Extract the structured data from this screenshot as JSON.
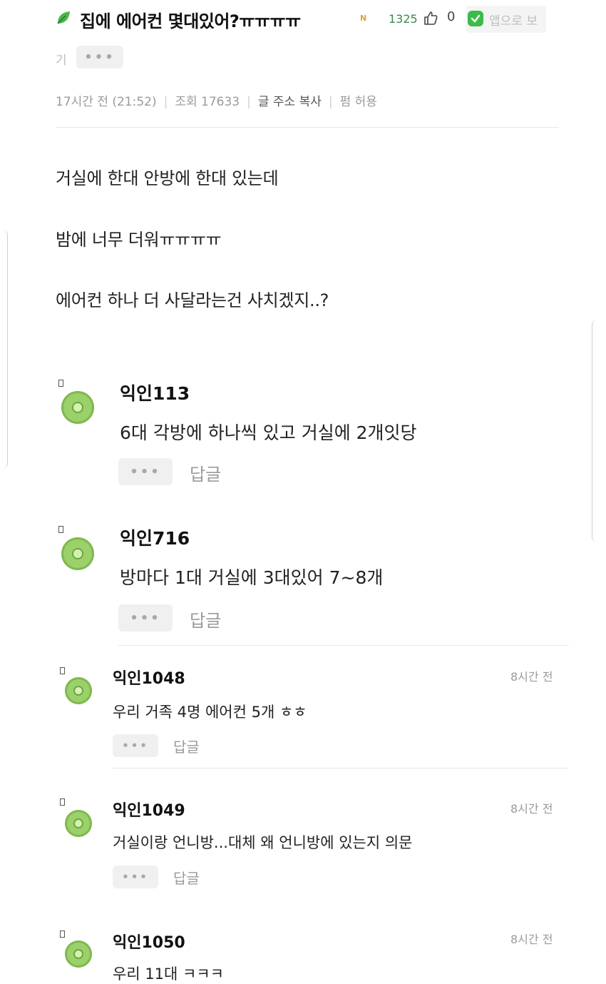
{
  "post": {
    "title": "집에 에어컨 몇대있어?ㅠㅠㅠㅠ",
    "new_badge": "N",
    "views_short": "1325",
    "likes": "0",
    "app_open_label": "앱으로 보",
    "app_open_label_cont": "기",
    "more_label": "•••",
    "meta": {
      "time": "17시간 전 (21:52)",
      "views": "조회 17633",
      "copy_link": "글 주소 복사",
      "permission": "펌 허용",
      "separator": "|"
    },
    "body_lines": [
      "거실에 한대 안방에 한대 있는데",
      "밤에 너무 더워ㅠㅠㅠㅠ",
      "에어컨 하나 더 사달라는건 사치겠지..?"
    ]
  },
  "comments": [
    {
      "nick": "익인113",
      "text": "6대 각방에 하나씩 있고 거실에 2개잇당",
      "reply": "답글",
      "more": "•••"
    },
    {
      "nick": "익인716",
      "text": "방마다 1대 거실에 3대있어 7~8개",
      "reply": "답글",
      "more": "•••"
    },
    {
      "nick": "익인1048",
      "text": "우리 거족 4명 에어컨 5개 ㅎㅎ",
      "reply": "답글",
      "more": "•••",
      "time": "8시간 전"
    },
    {
      "nick": "익인1049",
      "text": "거실이랑 언니방...대체 왜 언니방에 있는지 의문",
      "reply": "답글",
      "more": "•••",
      "time": "8시간 전"
    },
    {
      "nick": "익인1050",
      "text": "우리 11대 ㅋㅋㅋ",
      "time": "8시간 전"
    }
  ],
  "icons": {
    "leaf": "leaf-icon",
    "like": "thumbs-up-icon",
    "app": "app-check-icon",
    "accent_green": "#3cbb4a"
  }
}
